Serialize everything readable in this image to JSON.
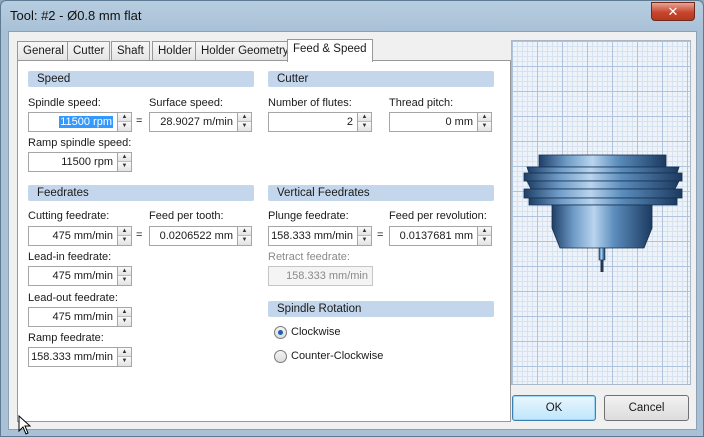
{
  "window": {
    "title": "Tool: #2 - Ø0.8 mm flat",
    "close_glyph": "✕"
  },
  "tabs": [
    {
      "label": "General",
      "active": false
    },
    {
      "label": "Cutter",
      "active": false
    },
    {
      "label": "Shaft",
      "active": false
    },
    {
      "label": "Holder",
      "active": false
    },
    {
      "label": "Holder Geometry",
      "active": false
    },
    {
      "label": "Feed & Speed",
      "active": true
    }
  ],
  "speed": {
    "header": "Speed",
    "spindle_speed_label": "Spindle speed:",
    "spindle_speed_value": "11500 rpm",
    "surface_speed_label": "Surface speed:",
    "surface_speed_value": "28.9027 m/min",
    "ramp_spindle_speed_label": "Ramp spindle speed:",
    "ramp_spindle_speed_value": "11500 rpm",
    "equals": "="
  },
  "cutter": {
    "header": "Cutter",
    "flutes_label": "Number of flutes:",
    "flutes_value": "2",
    "thread_pitch_label": "Thread pitch:",
    "thread_pitch_value": "0 mm"
  },
  "feedrates": {
    "header": "Feedrates",
    "cutting_label": "Cutting feedrate:",
    "cutting_value": "475 mm/min",
    "feed_per_tooth_label": "Feed per tooth:",
    "feed_per_tooth_value": "0.0206522 mm",
    "leadin_label": "Lead-in feedrate:",
    "leadin_value": "475 mm/min",
    "leadout_label": "Lead-out feedrate:",
    "leadout_value": "475 mm/min",
    "ramp_label": "Ramp feedrate:",
    "ramp_value": "158.333 mm/min",
    "equals": "="
  },
  "vertical_feedrates": {
    "header": "Vertical Feedrates",
    "plunge_label": "Plunge feedrate:",
    "plunge_value": "158.333 mm/min",
    "feed_per_rev_label": "Feed per revolution:",
    "feed_per_rev_value": "0.0137681 mm",
    "retract_label": "Retract feedrate:",
    "retract_value": "158.333 mm/min",
    "equals": "="
  },
  "spindle_rotation": {
    "header": "Spindle Rotation",
    "clockwise_label": "Clockwise",
    "counter_clockwise_label": "Counter-Clockwise",
    "selected": "Clockwise"
  },
  "buttons": {
    "ok": "OK",
    "cancel": "Cancel"
  },
  "colors": {
    "section_header": "#c3d6ec",
    "tool_steel": "#4b7fb0",
    "selection": "#3399ff"
  }
}
